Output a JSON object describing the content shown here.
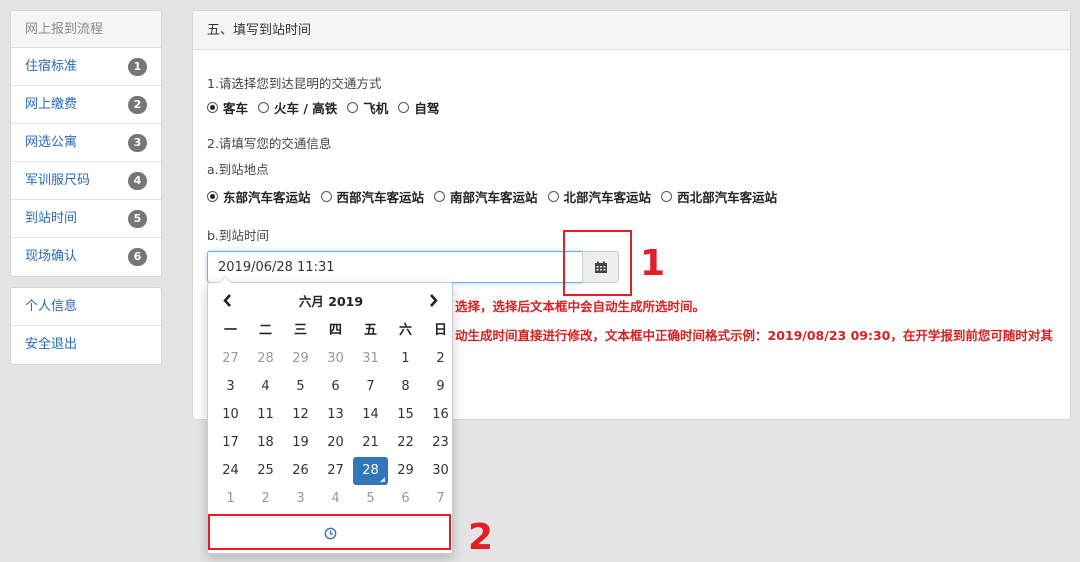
{
  "sidebar": {
    "header": "网上报到流程",
    "items": [
      {
        "label": "住宿标准",
        "badge": "1"
      },
      {
        "label": "网上缴费",
        "badge": "2"
      },
      {
        "label": "网选公寓",
        "badge": "3"
      },
      {
        "label": "军训服尺码",
        "badge": "4"
      },
      {
        "label": "到站时间",
        "badge": "5"
      },
      {
        "label": "现场确认",
        "badge": "6"
      }
    ],
    "bottom_items": [
      {
        "label": "个人信息"
      },
      {
        "label": "安全退出"
      }
    ]
  },
  "panel": {
    "title": "五、填写到站时间",
    "q1": "1.请选择您到达昆明的交通方式",
    "transport_options": [
      "客车",
      "火车 / 高铁",
      "飞机",
      "自驾"
    ],
    "transport_selected": 0,
    "q2": "2.请填写您的交通信息",
    "q2a": "a.到站地点",
    "station_options": [
      "东部汽车客运站",
      "西部汽车客运站",
      "南部汽车客运站",
      "北部汽车客运站",
      "西北部汽车客运站"
    ],
    "station_selected": 0,
    "q2b": "b.到站时间",
    "date_value": "2019/06/28 11:31",
    "notice_1": "选择，选择后文本框中会自动生成所选时间。",
    "notice_2": "动生成时间直接进行修改，文本框中正确时间格式示例：2019/08/23 09:30，在开学报到前您可随时对其"
  },
  "annotations": {
    "label_1": "1",
    "label_2": "2",
    "color": "#e21e26"
  },
  "datepicker": {
    "title": "六月 2019",
    "prev_icon": "chevron-left",
    "next_icon": "chevron-right",
    "weekdays": [
      "一",
      "二",
      "三",
      "四",
      "五",
      "六",
      "日"
    ],
    "weeks": [
      [
        "27",
        "28",
        "29",
        "30",
        "31",
        "1",
        "2"
      ],
      [
        "3",
        "4",
        "5",
        "6",
        "7",
        "8",
        "9"
      ],
      [
        "10",
        "11",
        "12",
        "13",
        "14",
        "15",
        "16"
      ],
      [
        "17",
        "18",
        "19",
        "20",
        "21",
        "22",
        "23"
      ],
      [
        "24",
        "25",
        "26",
        "27",
        "28",
        "29",
        "30"
      ],
      [
        "1",
        "2",
        "3",
        "4",
        "5",
        "6",
        "7"
      ]
    ],
    "selected_day": "28",
    "footer_icon": "clock-icon",
    "accent": "#3477b9"
  }
}
